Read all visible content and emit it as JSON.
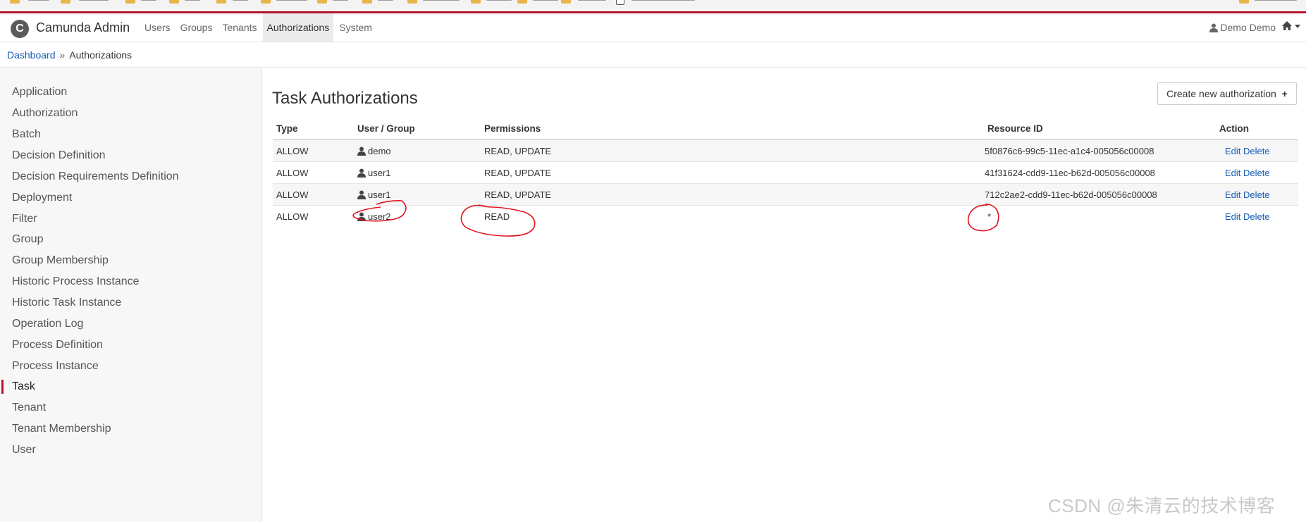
{
  "app": {
    "brand": "Camunda Admin",
    "nav": [
      {
        "label": "Users"
      },
      {
        "label": "Groups"
      },
      {
        "label": "Tenants"
      },
      {
        "label": "Authorizations",
        "active": true
      },
      {
        "label": "System"
      }
    ],
    "user_menu": "Demo Demo"
  },
  "breadcrumb": {
    "home": "Dashboard",
    "separator": "»",
    "current": "Authorizations"
  },
  "sidebar": {
    "items": [
      {
        "label": "Application"
      },
      {
        "label": "Authorization"
      },
      {
        "label": "Batch"
      },
      {
        "label": "Decision Definition"
      },
      {
        "label": "Decision Requirements Definition"
      },
      {
        "label": "Deployment"
      },
      {
        "label": "Filter"
      },
      {
        "label": "Group"
      },
      {
        "label": "Group Membership"
      },
      {
        "label": "Historic Process Instance"
      },
      {
        "label": "Historic Task Instance"
      },
      {
        "label": "Operation Log"
      },
      {
        "label": "Process Definition"
      },
      {
        "label": "Process Instance"
      },
      {
        "label": "Task",
        "active": true
      },
      {
        "label": "Tenant"
      },
      {
        "label": "Tenant Membership"
      },
      {
        "label": "User"
      }
    ]
  },
  "main": {
    "title": "Task Authorizations",
    "create_button": "Create new authorization",
    "create_icon": "+",
    "columns": [
      "Type",
      "User / Group",
      "Permissions",
      "Resource ID",
      "Action"
    ],
    "rows": [
      {
        "type": "ALLOW",
        "user": "demo",
        "permissions": "READ, UPDATE",
        "resource_id": "5f0876c6-99c5-11ec-a1c4-005056c00008",
        "edit": "Edit",
        "delete": "Delete"
      },
      {
        "type": "ALLOW",
        "user": "user1",
        "permissions": "READ, UPDATE",
        "resource_id": "41f31624-cdd9-11ec-b62d-005056c00008",
        "edit": "Edit",
        "delete": "Delete"
      },
      {
        "type": "ALLOW",
        "user": "user1",
        "permissions": "READ, UPDATE",
        "resource_id": "712c2ae2-cdd9-11ec-b62d-005056c00008",
        "edit": "Edit",
        "delete": "Delete"
      },
      {
        "type": "ALLOW",
        "user": "user2",
        "permissions": "READ",
        "resource_id": "*",
        "edit": "Edit",
        "delete": "Delete"
      }
    ]
  },
  "watermark": "CSDN @朱清云的技术博客",
  "colors": {
    "accent": "#b5152b",
    "link": "#155cb5",
    "annotation": "#e0141e"
  }
}
